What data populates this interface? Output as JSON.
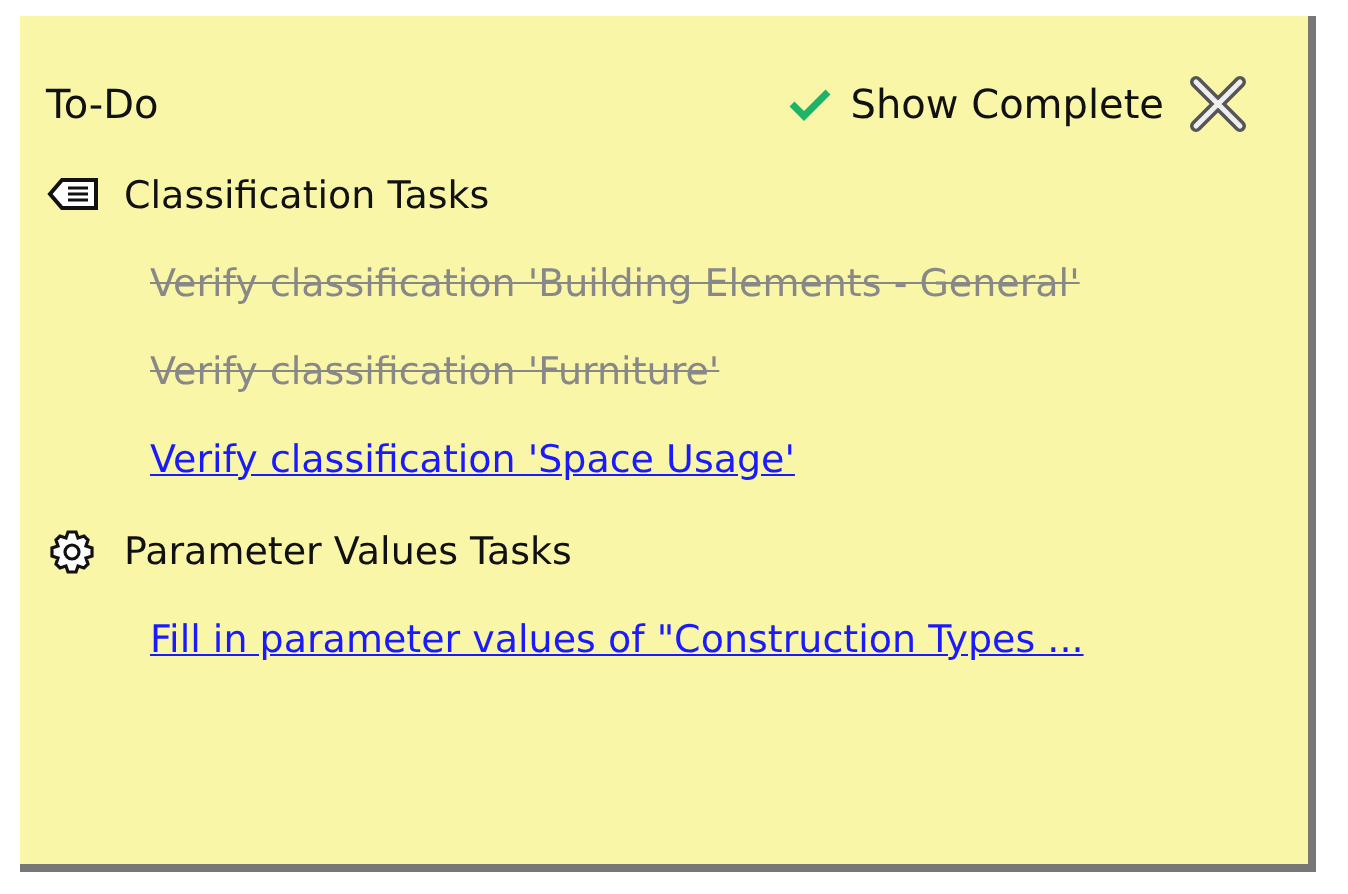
{
  "panel": {
    "title": "To-Do",
    "show_complete": {
      "label": "Show Complete",
      "checked": true
    }
  },
  "groups": [
    {
      "kind": "tag",
      "title": "Classification Tasks",
      "tasks": [
        {
          "label": "Verify classification 'Building Elements - General'",
          "completed": true
        },
        {
          "label": "Verify classification 'Furniture'",
          "completed": true
        },
        {
          "label": "Verify classification 'Space Usage'",
          "completed": false
        }
      ]
    },
    {
      "kind": "gear",
      "title": "Parameter Values Tasks",
      "tasks": [
        {
          "label": "Fill in parameter values of \"Construction Types ...",
          "completed": false
        }
      ]
    }
  ]
}
